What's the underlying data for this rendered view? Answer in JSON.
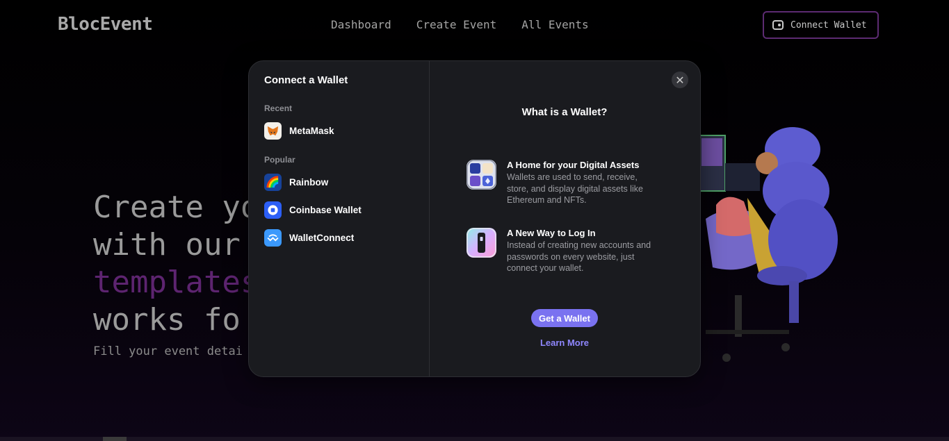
{
  "app": {
    "logo": "BlocEvent"
  },
  "nav": {
    "items": [
      "Dashboard",
      "Create Event",
      "All Events"
    ],
    "connect_label": "Connect Wallet"
  },
  "hero": {
    "line1": "Create yo",
    "line2": "with our",
    "line3": "templates",
    "line4": "works fo",
    "subtitle": "Fill your event detai",
    "accent_color": "#5d2470"
  },
  "modal": {
    "title": "Connect a Wallet",
    "recent_label": "Recent",
    "popular_label": "Popular",
    "recent": [
      {
        "name": "MetaMask",
        "icon": "metamask-fox-icon"
      }
    ],
    "popular": [
      {
        "name": "Rainbow",
        "icon": "rainbow-icon"
      },
      {
        "name": "Coinbase Wallet",
        "icon": "coinbase-icon"
      },
      {
        "name": "WalletConnect",
        "icon": "walletconnect-icon"
      }
    ],
    "close_icon": "close-icon",
    "right_title": "What is a Wallet?",
    "info": [
      {
        "title": "A Home for your Digital Assets",
        "desc": "Wallets are used to send, receive, store, and display digital assets like Ethereum and NFTs.",
        "icon": "assets-grid-icon"
      },
      {
        "title": "A New Way to Log In",
        "desc": "Instead of creating new accounts and passwords on every website, just connect your wallet.",
        "icon": "login-key-icon"
      }
    ],
    "get_wallet_label": "Get a Wallet",
    "learn_more_label": "Learn More",
    "accent_color": "#7a72f0"
  }
}
